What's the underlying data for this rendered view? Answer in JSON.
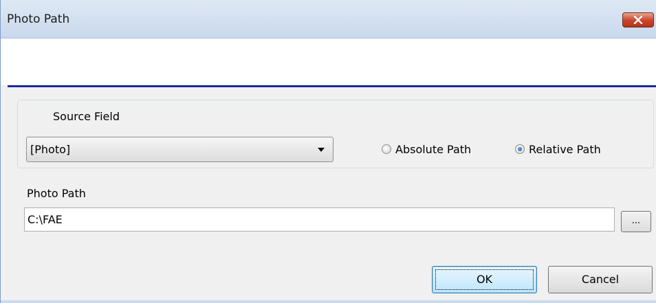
{
  "window": {
    "title": "Photo Path"
  },
  "source": {
    "label": "Source Field",
    "selected": "[Photo]",
    "path_mode": "Relative Path"
  },
  "radios": {
    "absolute_label": "Absolute Path",
    "relative_label": "Relative Path"
  },
  "photo_path": {
    "label": "Photo Path",
    "value": "C:\\FAE",
    "browse_label": "..."
  },
  "buttons": {
    "ok": "OK",
    "cancel": "Cancel"
  },
  "colors": {
    "header_line": "#1a2aa0",
    "close_button": "#c8442a"
  },
  "icons": {
    "close": "close-icon",
    "dropdown": "chevron-down-icon"
  }
}
